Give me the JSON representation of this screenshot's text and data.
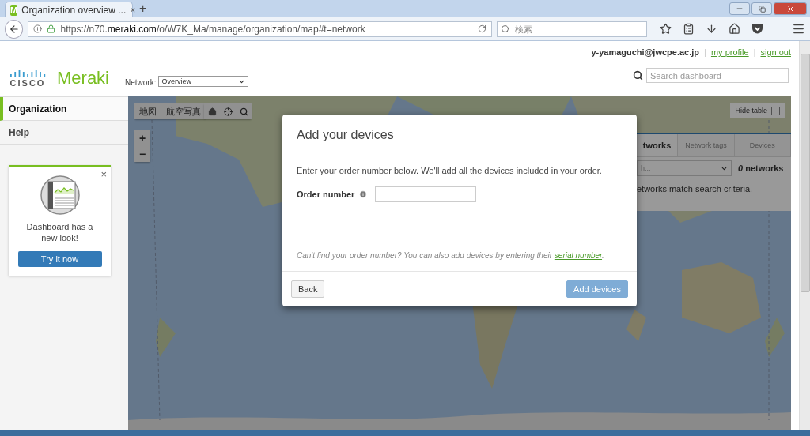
{
  "browser": {
    "tab": {
      "favicon": "M",
      "title": "Organization overview ...",
      "close": "×"
    },
    "new_tab": "+",
    "url": "https://n70.**meraki.com**/o/W7K_Ma/manage/organization/map#t=network",
    "search": {
      "placeholder": "検索"
    }
  },
  "header": {
    "logo": {
      "brand": "CISCO",
      "product": "Meraki"
    },
    "user": "y-yamaguchi@jwcpe.ac.jp",
    "separator": "|",
    "links": [
      "my profile",
      "sign out"
    ],
    "network": {
      "label": "Network:",
      "value": "Overview"
    },
    "search": {
      "placeholder": "Search dashboard"
    }
  },
  "sidebar": {
    "items": [
      {
        "label": "Organization",
        "selected": true
      },
      {
        "label": "Help",
        "selected": false
      }
    ],
    "promo": {
      "close": "×",
      "text": "Dashboard has a new look!",
      "button": "Try it now"
    }
  },
  "map": {
    "type_buttons": [
      "地図",
      "航空写真"
    ],
    "zoom": [
      "+",
      "−"
    ],
    "hide_table": {
      "label": "Hide table",
      "checked": false
    },
    "table": {
      "tabs": [
        {
          "label": "tworks",
          "selected": true
        },
        {
          "label": "Network tags",
          "selected": false
        },
        {
          "label": "Devices",
          "selected": false
        }
      ],
      "search": {
        "placeholder": "h..."
      },
      "count": "*0* networks",
      "message": "etworks match search criteria."
    }
  },
  "dialog": {
    "title": "Add your devices",
    "intro": "Enter your order number below. We'll add all the devices included in your order.",
    "field": {
      "label": "Order number"
    },
    "hint": "Can't find your order number? You can also add devices by entering their",
    "link": "serial number",
    "hint_end": ".",
    "buttons": [
      {
        "label": "Back",
        "kind": "secondary",
        "disabled": false
      },
      {
        "label": "Add devices",
        "kind": "primary",
        "disabled": true
      }
    ]
  }
}
